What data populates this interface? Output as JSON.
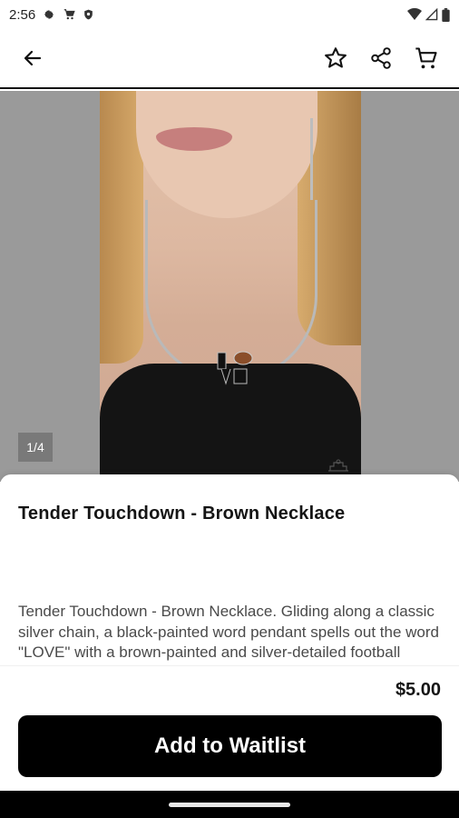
{
  "status_bar": {
    "time": "2:56",
    "icons": [
      "settings-icon",
      "cart-notification-icon",
      "shield-icon",
      "wifi-icon",
      "signal-icon",
      "battery-icon"
    ]
  },
  "app_bar": {
    "icons": [
      "back-arrow-icon",
      "star-icon",
      "share-icon",
      "cart-icon"
    ]
  },
  "gallery": {
    "page_indicator": "1/4"
  },
  "product": {
    "title": "Tender Touchdown - Brown Necklace",
    "description": "Tender Touchdown - Brown Necklace.  Gliding along a classic silver chain, a black-painted word pendant spells out the word \"LOVE\" with a brown-painted and silver-detailed football replacing the \"O\" for a",
    "price": "$5.00",
    "cta_label": "Add to Waitlist"
  },
  "colors": {
    "accent": "#000000",
    "gallery_bg": "#9a9a9a",
    "text_primary": "#151515",
    "text_secondary": "#4a4a4a"
  }
}
